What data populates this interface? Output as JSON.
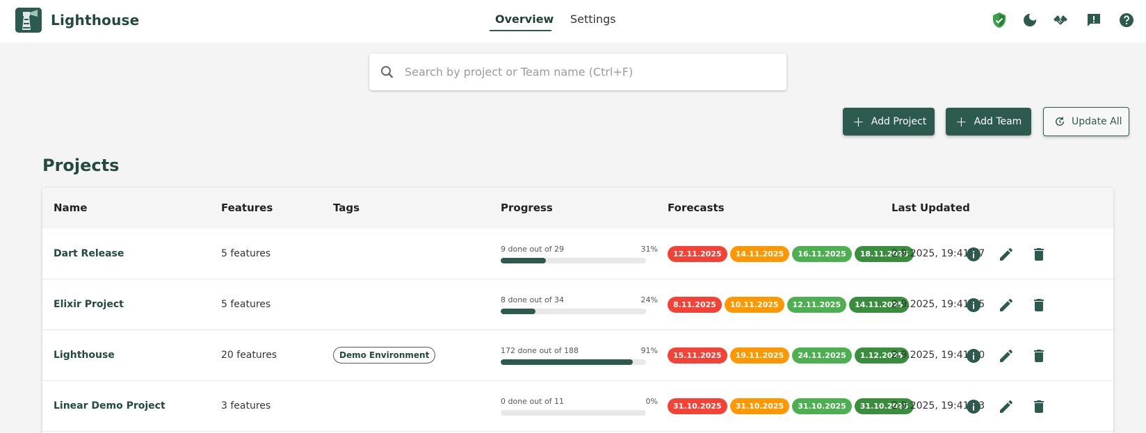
{
  "header": {
    "brand": "Lighthouse",
    "tabs": [
      {
        "label": "Overview",
        "active": true
      },
      {
        "label": "Settings",
        "active": false
      }
    ],
    "icons": [
      "shield-check-icon",
      "dark-mode-icon",
      "handshake-icon",
      "feedback-icon",
      "help-icon"
    ]
  },
  "search": {
    "placeholder": "Search by project or Team name (Ctrl+F)",
    "value": ""
  },
  "actions": {
    "add_project": "Add Project",
    "add_team": "Add Team",
    "update_all": "Update All"
  },
  "projects": {
    "title": "Projects",
    "columns": [
      "Name",
      "Features",
      "Tags",
      "Progress",
      "Forecasts",
      "Last Updated"
    ],
    "forecast_colors": [
      "#f44336",
      "#ff9800",
      "#4caf50",
      "#388e3c"
    ],
    "rows": [
      {
        "name": "Dart Release",
        "features": "5 features",
        "tag": "",
        "progress_text": "9 done out of 29",
        "progress_pct": "31%",
        "progress_fraction": 0.31,
        "forecasts": [
          "12.11.2025",
          "14.11.2025",
          "16.11.2025",
          "18.11.2025"
        ],
        "last_updated": "2.9.2025, 19:41:27"
      },
      {
        "name": "Elixir Project",
        "features": "5 features",
        "tag": "",
        "progress_text": "8 done out of 34",
        "progress_pct": "24%",
        "progress_fraction": 0.24,
        "forecasts": [
          "8.11.2025",
          "10.11.2025",
          "12.11.2025",
          "14.11.2025"
        ],
        "last_updated": "2.9.2025, 19:41:25"
      },
      {
        "name": "Lighthouse",
        "features": "20 features",
        "tag": "Demo Environment",
        "progress_text": "172 done out of 188",
        "progress_pct": "91%",
        "progress_fraction": 0.91,
        "forecasts": [
          "15.11.2025",
          "19.11.2025",
          "24.11.2025",
          "1.12.2025"
        ],
        "last_updated": "2.9.2025, 19:41:30"
      },
      {
        "name": "Linear Demo Project",
        "features": "3 features",
        "tag": "",
        "progress_text": "0 done out of 11",
        "progress_pct": "0%",
        "progress_fraction": 0.0,
        "forecasts": [
          "31.10.2025",
          "31.10.2025",
          "31.10.2025",
          "31.10.2025"
        ],
        "last_updated": "2.9.2025, 19:41:33"
      }
    ]
  }
}
